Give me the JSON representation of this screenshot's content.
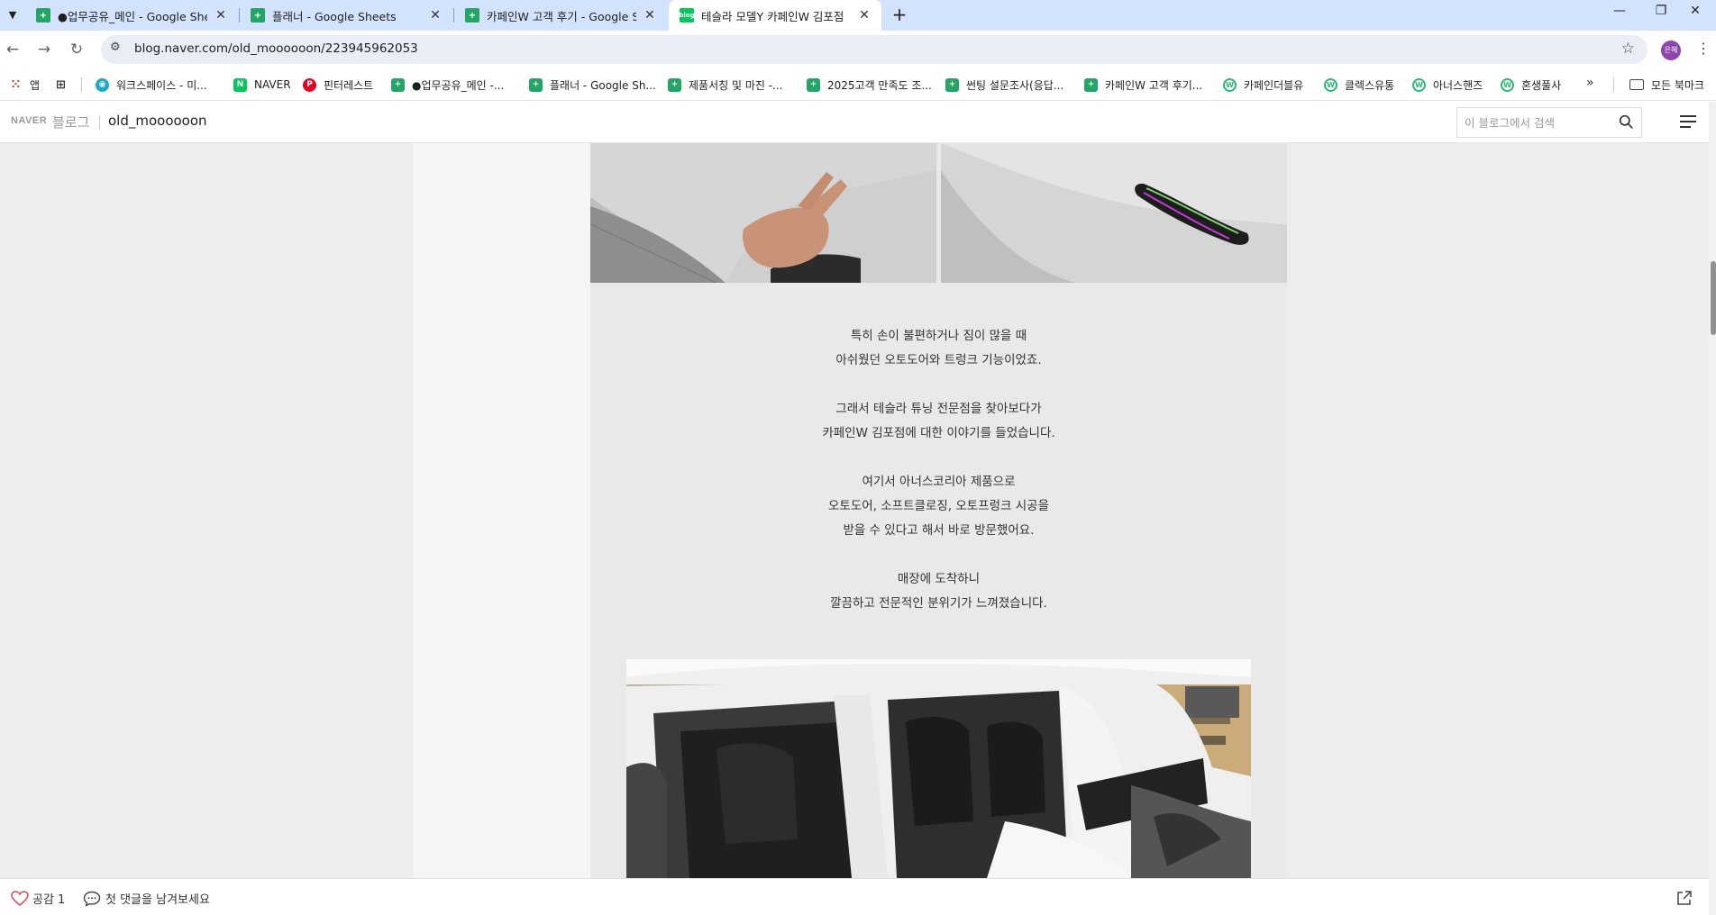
{
  "browser": {
    "tabs": [
      {
        "title": "●업무공유_메인 - Google Sheets",
        "favicon": "sheets-icon"
      },
      {
        "title": "플래너 - Google Sheets",
        "favicon": "sheets-icon"
      },
      {
        "title": "카페인W 고객 후기 - Google Sheets",
        "favicon": "sheets-icon"
      },
      {
        "title": "테슬라 모델Y 카페인W 김포점",
        "favicon": "naver-blog-icon",
        "active": true
      }
    ],
    "url": "blog.naver.com/old_moooooon/223945962053",
    "profile_initial": "은혜",
    "bookmarks": [
      {
        "label": "앱",
        "icon": "apps-icon"
      },
      {
        "label": "",
        "icon": "grid-icon"
      },
      {
        "label": "워크스페이스 - 미...",
        "icon": "workspace-icon"
      },
      {
        "label": "NAVER",
        "icon": "naver-icon"
      },
      {
        "label": "핀터레스트",
        "icon": "pinterest-icon"
      },
      {
        "label": "●업무공유_메인 -...",
        "icon": "sheets-icon"
      },
      {
        "label": "플래너 - Google Sh...",
        "icon": "sheets-icon"
      },
      {
        "label": "제품서칭 및 마진 -...",
        "icon": "sheets-icon"
      },
      {
        "label": "2025고객 만족도 조...",
        "icon": "sheets-icon"
      },
      {
        "label": "썬팅 설문조사(응답...",
        "icon": "sheets-icon"
      },
      {
        "label": "카페인W 고객 후기...",
        "icon": "sheets-icon"
      },
      {
        "label": "카페인더블유",
        "icon": "w-icon"
      },
      {
        "label": "클렉스유통",
        "icon": "w-icon"
      },
      {
        "label": "아너스핸즈",
        "icon": "w-icon"
      },
      {
        "label": "혼생풀사",
        "icon": "w-icon"
      }
    ],
    "all_bookmarks": "모든 북마크"
  },
  "blog": {
    "naver_logo": "NAVER",
    "blog_word": "블로그",
    "blog_id": "old_moooooon",
    "search_placeholder": "이 블로그에서 검색"
  },
  "post": {
    "paragraphs": [
      [
        "특히 손이 불편하거나 짐이 많을 때",
        "아쉬웠던 오토도어와 트렁크 기능이었죠."
      ],
      [
        "그래서 테슬라 튜닝 전문점을 찾아보다가",
        "카페인W 김포점에 대한 이야기를 들었습니다."
      ],
      [
        "여기서 아너스코리아 제품으로",
        "오토도어, 소프트클로징, 오토프렁크 시공을",
        "받을 수 있다고 해서 바로 방문했어요."
      ],
      [
        "매장에 도착하니",
        "깔끔하고 전문적인 분위기가 느껴졌습니다."
      ]
    ]
  },
  "bottom_bar": {
    "like_label": "공감 1",
    "comment_label": "첫 댓글을 남겨보세요"
  }
}
